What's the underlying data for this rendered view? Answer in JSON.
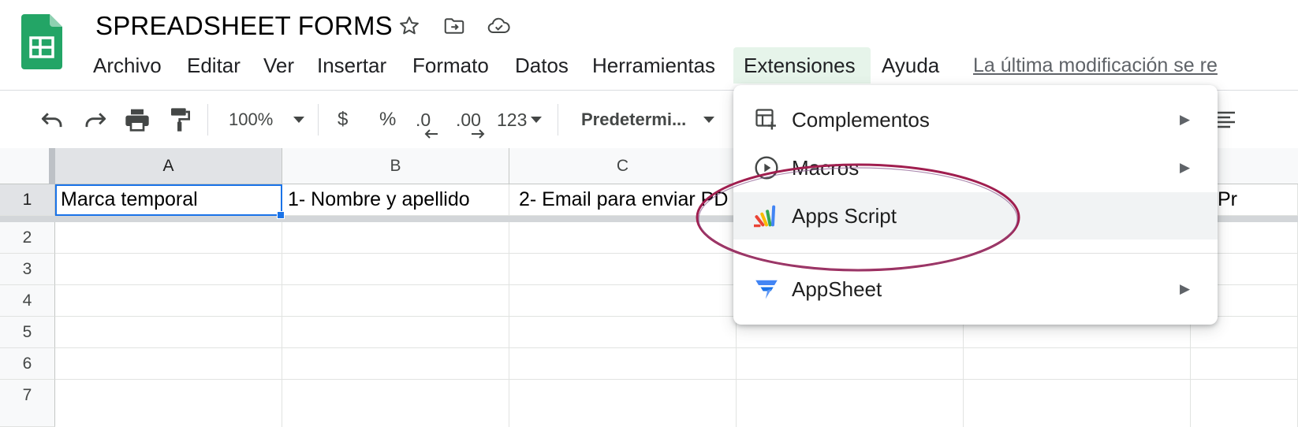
{
  "app": {
    "title": "SPREADSHEET FORMS",
    "last_modified": "La última modificación se re"
  },
  "menubar": {
    "items": [
      {
        "label": "Archivo"
      },
      {
        "label": "Editar"
      },
      {
        "label": "Ver"
      },
      {
        "label": "Insertar"
      },
      {
        "label": "Formato"
      },
      {
        "label": "Datos"
      },
      {
        "label": "Herramientas"
      },
      {
        "label": "Extensiones"
      },
      {
        "label": "Ayuda"
      }
    ]
  },
  "toolbar": {
    "zoom": "100%",
    "currency": "$",
    "percent": "%",
    "decrease_decimals": ".0",
    "increase_decimals": ".00",
    "number_format": "123",
    "font": "Predetermi..."
  },
  "grid": {
    "columns": [
      "A",
      "B",
      "C"
    ],
    "rows": [
      "1",
      "2",
      "3",
      "4",
      "5",
      "6",
      "7"
    ],
    "row1": [
      "Marca temporal",
      "1- Nombre y apellido",
      "2- Email para enviar PD"
    ],
    "right_edge_text": "Pr"
  },
  "extensions_menu": {
    "items": [
      {
        "label": "Complementos",
        "icon": "add-ons-icon",
        "submenu": true
      },
      {
        "label": "Macros",
        "icon": "play-circle-icon",
        "submenu": true
      },
      {
        "label": "Apps Script",
        "icon": "apps-script-icon",
        "submenu": false
      },
      {
        "label": "AppSheet",
        "icon": "appsheet-icon",
        "submenu": true
      }
    ],
    "submenu_arrow": "▶"
  },
  "colors": {
    "sheets_green": "#0F9D58",
    "active_menu_bg": "#e6f4ea",
    "selection_blue": "#1a73e8",
    "annotation": "#a01e4f"
  }
}
